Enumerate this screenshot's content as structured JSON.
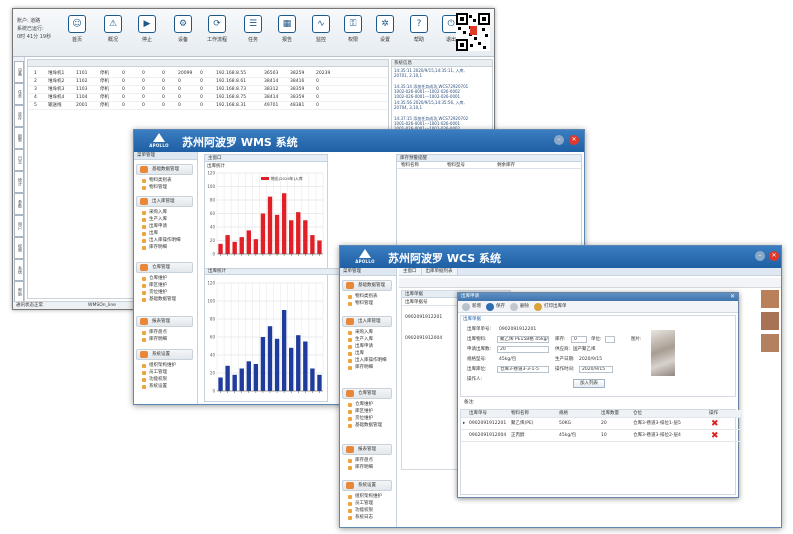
{
  "w1": {
    "header": {
      "line1": "账户: 道路",
      "line2": "系统已运行:",
      "line3": "0时 41分 19秒"
    },
    "toolbar": [
      "首页",
      "概况",
      "停止",
      "设备",
      "工作流程",
      "任务",
      "报告",
      "监控",
      "权限",
      "设置",
      "帮助",
      "退出"
    ],
    "toolbar_icons": [
      "home-icon",
      "warning-icon",
      "stop-icon",
      "device-icon",
      "workflow-icon",
      "task-icon",
      "report-icon",
      "monitor-icon",
      "lock-icon",
      "gear-icon",
      "help-icon",
      "power-icon"
    ],
    "vtabs": [
      "设备",
      "任务",
      "库存",
      "报警",
      "日志",
      "统计",
      "参数",
      "用户",
      "权限",
      "系统",
      "帮助"
    ],
    "grid_rows": [
      [
        "1",
        "堆垛机1",
        "1101",
        "停机",
        "0",
        "0",
        "0",
        "20099",
        "0",
        "192.168.8.55",
        "36503",
        "38259",
        "20239"
      ],
      [
        "2",
        "堆垛机2",
        "1102",
        "停机",
        "0",
        "0",
        "0",
        "0",
        "0",
        "192.168.8.61",
        "38414",
        "38416",
        "0"
      ],
      [
        "3",
        "堆垛机3",
        "1103",
        "停机",
        "0",
        "0",
        "0",
        "0",
        "0",
        "192.168.8.73",
        "38312",
        "38359",
        "0"
      ],
      [
        "4",
        "堆垛机4",
        "1104",
        "停机",
        "0",
        "0",
        "0",
        "0",
        "0",
        "192.168.8.75",
        "38414",
        "38359",
        "0"
      ],
      [
        "5",
        "输送线",
        "2001",
        "停机",
        "0",
        "0",
        "0",
        "0",
        "0",
        "192.168.8.31",
        "49701",
        "48381",
        "0"
      ]
    ],
    "log_title": "系统信息",
    "log_lines": [
      "14:35:11 2020/9/15,14:35:11, 入库,",
      "20701, 2,10,1",
      "",
      "14:35:14 添加任务成功,WCS72920701",
      "1002-026-0001---1002-026-0002",
      "1002-026-0001---1002-026-0001",
      "14:35:56 2020/9/15,14:35:56, 入库,",
      "20704, 3,10,1",
      "",
      "14:37:15 添加任务成功,WCS72920702",
      "1001-026-0001---1001-026-0001",
      "1001-026-0001---1001-026-0002",
      "14:37:46 2020/9/15,14:37:46, 入库,",
      "20704, 3,10,1",
      "",
      "14:37:49 添加任务成功"
    ],
    "status_left": "通讯状态正常",
    "status_mid": "WMSOn_line"
  },
  "wms": {
    "title": "苏州阿波罗 WMS 系统",
    "logo_text": "APOLLO",
    "sidebar_head": "菜单管理",
    "sections": [
      {
        "label": "基础数据管理",
        "items": [
          "物料类别表",
          "物料管理"
        ]
      },
      {
        "label": "出入库管理",
        "items": [
          "采购入库",
          "生产入库",
          "出库申请",
          "出库",
          "出入库操作明细",
          "库存明细"
        ]
      },
      {
        "label": "仓库管理",
        "items": [
          "仓库维护",
          "库区维护",
          "货位维护",
          "基础数据管理"
        ]
      },
      {
        "label": "报表管理",
        "items": [
          "库存盘点",
          "库存明细"
        ]
      },
      {
        "label": "系统设置",
        "items": [
          "组织架构维护",
          "员工管理",
          "功能权限",
          "系统设置"
        ]
      }
    ],
    "main_title": "主窗口",
    "chart1_title": "出库统计",
    "chart2_title": "出库统计",
    "right_title": "库存预警提醒",
    "right_headers": [
      "物料名称",
      "物料型号",
      "剩余库存"
    ]
  },
  "wcs": {
    "title": "苏州阿波罗 WCS 系统",
    "logo_text": "APOLLO",
    "sidebar_head": "菜单管理",
    "sections": [
      {
        "label": "基础数据管理",
        "items": [
          "物料类别表",
          "物料管理"
        ]
      },
      {
        "label": "出入库管理",
        "items": [
          "采购入库",
          "生产入库",
          "出库申请",
          "出库",
          "出入库操作明细",
          "库存明细"
        ]
      },
      {
        "label": "仓库管理",
        "items": [
          "仓库维护",
          "库区维护",
          "货位维护",
          "基础数据管理"
        ]
      },
      {
        "label": "报表管理",
        "items": [
          "库存盘点",
          "库存明细"
        ]
      },
      {
        "label": "系统设置",
        "items": [
          "组织架构维护",
          "员工管理",
          "功能权限",
          "系统日志"
        ]
      }
    ],
    "tabs": [
      "主窗口",
      "出库单据列表"
    ],
    "list_title": "出库单据",
    "list_headers": [
      "出库单据号",
      "日期"
    ],
    "list_rows": [
      "0902091912201",
      "0902091912004"
    ],
    "dialog": {
      "title": "出库申请",
      "toolbar": [
        "新增",
        "保存",
        "删除",
        "打印出库单"
      ],
      "group": "出库单据",
      "f_no_label": "出库单单号:",
      "f_no": "0902091912201",
      "f_mat_label": "出库物料:",
      "f_mat": "聚乙烯 PE15B格 45kg/包",
      "f_qty_label": "申请出库数:",
      "f_qty": "20",
      "f_spec_label": "规格型号:",
      "f_spec": "45kg/包",
      "f_wh_label": "出库库位:",
      "f_wh": "仓库3-巷道3-3-1-5",
      "f_op_label": "操作人:",
      "f_stock_label": "库存:",
      "f_stock": "0",
      "f_unit_label": "单位:",
      "f_batch_label": "供应商:",
      "f_batch": "国产聚乙烯",
      "f_date_label": "生产日期:",
      "f_date": "2020/9/15",
      "f_pic_label": "图片:",
      "f_user_label": "操作时间:",
      "f_user": "2020/9/15",
      "add_btn": "加入列表",
      "note_label": "备注:",
      "grid_headers": [
        "出库单号",
        "物料名称",
        "规格",
        "出库数量",
        "仓位",
        "操作"
      ],
      "grid_rows": [
        [
          "0902091912201",
          "聚乙烯(PE)",
          "50KG",
          "20",
          "仓库3-巷道3-排位1-层5"
        ],
        [
          "0902091912004",
          "正丙醇",
          "45kg/包",
          "10",
          "仓库3-巷道3-排位2-层4"
        ]
      ]
    }
  },
  "chart_data": [
    {
      "type": "bar",
      "title": "出库统计",
      "legend": [
        "物出(2019年)入库"
      ],
      "color": "#e01f26",
      "ylim": [
        0,
        120
      ],
      "yticks": [
        0,
        20,
        40,
        60,
        80,
        100,
        120
      ],
      "values": [
        15,
        28,
        18,
        25,
        35,
        22,
        60,
        85,
        58,
        90,
        50,
        62,
        50,
        28,
        20
      ],
      "grid": true
    },
    {
      "type": "bar",
      "title": "出库统计",
      "color": "#1f3b9c",
      "ylim": [
        0,
        120
      ],
      "yticks": [
        0,
        20,
        40,
        60,
        80,
        100,
        120
      ],
      "values": [
        15,
        28,
        18,
        25,
        33,
        30,
        60,
        72,
        58,
        90,
        48,
        62,
        55,
        25,
        18
      ],
      "grid": true
    }
  ]
}
